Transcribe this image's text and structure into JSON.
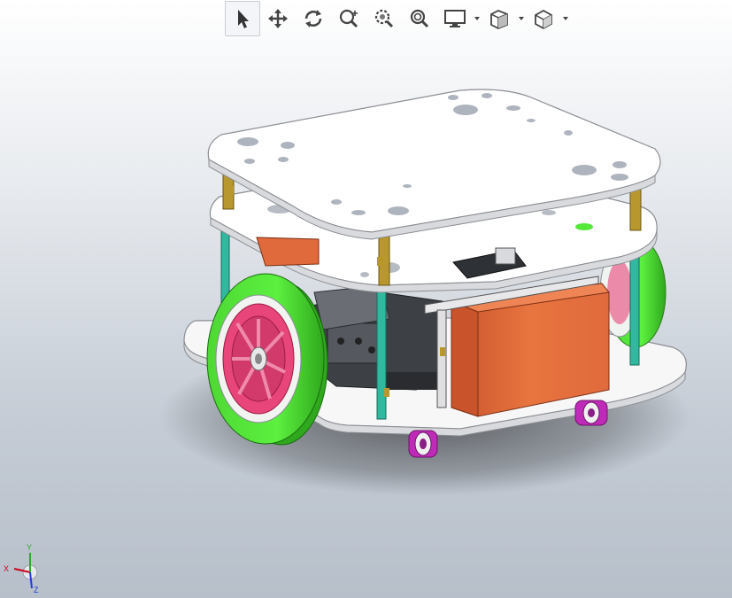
{
  "toolbar": {
    "tools": [
      {
        "id": "select",
        "icon": "select-arrow-icon",
        "active": true
      },
      {
        "id": "pan",
        "icon": "pan-icon",
        "active": false
      },
      {
        "id": "rotate",
        "icon": "rotate-icon",
        "active": false
      },
      {
        "id": "zoom-to-fit",
        "icon": "zoom-to-fit-icon",
        "active": false
      },
      {
        "id": "zoom-to-area",
        "icon": "zoom-to-area-icon",
        "active": false
      },
      {
        "id": "zoom-in-out",
        "icon": "zoom-in-out-icon",
        "active": false
      },
      {
        "id": "display-style",
        "icon": "display-monitor-icon",
        "dropdown": true
      },
      {
        "id": "section-view",
        "icon": "section-view-icon",
        "dropdown": true
      },
      {
        "id": "view-orientation",
        "icon": "view-cube-icon",
        "dropdown": true
      }
    ]
  },
  "triad": {
    "x_label": "X",
    "y_label": "Y",
    "z_label": "Z",
    "colors": {
      "x": "#d0021b",
      "y": "#2ea82e",
      "z": "#1f3fd6"
    }
  },
  "model": {
    "name_icon": "robot-chassis-model",
    "colors": {
      "plate": "#ffffff",
      "plate_edge": "#8a8d92",
      "wheel_tire": "#55e839",
      "wheel_hub": "#e8457a",
      "standoff": "#33b8a0",
      "brass": "#b8972e",
      "battery": "#e06a3c",
      "caster": "#c02ab8",
      "motor": "#4a4d52"
    }
  }
}
